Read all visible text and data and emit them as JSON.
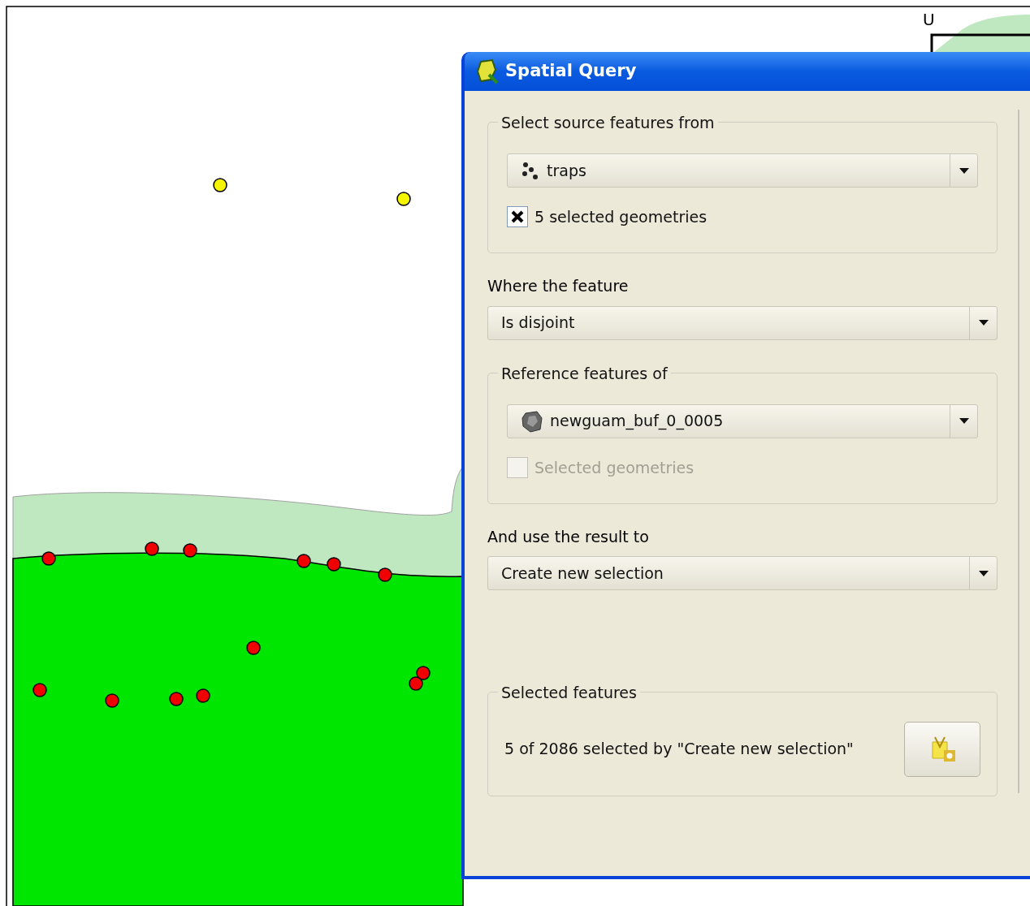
{
  "window": {
    "title": "Spatial Query"
  },
  "source": {
    "legend": "Select source features from",
    "layer": "traps",
    "kind": "point",
    "selected_only": {
      "label": "5 selected geometries",
      "checked": true,
      "disabled": false
    }
  },
  "predicate": {
    "label": "Where the feature",
    "value": "Is disjoint"
  },
  "reference": {
    "legend": "Reference features of",
    "layer": "newguam_buf_0_0005",
    "kind": "polygon",
    "selected_only": {
      "label": "Selected geometries",
      "checked": false,
      "disabled": true
    }
  },
  "result_action": {
    "label": "And use the result to",
    "value": "Create new selection"
  },
  "selected_features": {
    "legend": "Selected features",
    "summary": "5 of 2086 selected by \"Create new selection\""
  },
  "map": {
    "labels": [
      "U"
    ]
  }
}
